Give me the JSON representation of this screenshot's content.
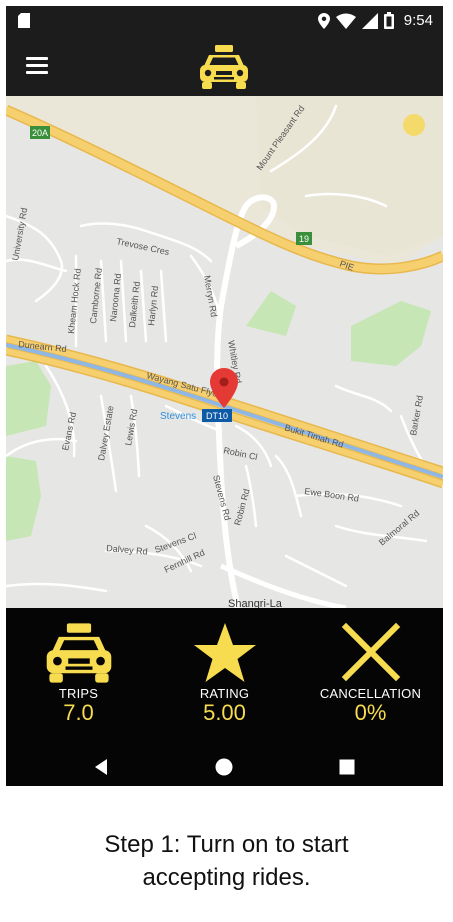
{
  "status_bar": {
    "time": "9:54",
    "icons": [
      "sd-card-icon",
      "location-icon",
      "wifi-icon",
      "signal-icon",
      "battery-icon"
    ]
  },
  "toolbar": {
    "menu_icon": "hamburger-menu-icon",
    "logo": "taxi-logo"
  },
  "map": {
    "labels": {
      "road_20a": "20A",
      "road_19": "19",
      "pie": "PIE",
      "mount_pleasant": "Mount Pleasant Rd",
      "university": "University Rd",
      "trevose": "Trevose Cres",
      "kheam_hock": "Kheam Hock Rd",
      "camborne": "Camborne Rd",
      "naroona": "Naroona Rd",
      "dalkeith": "Dalkeith Rd",
      "harlyn": "Harlyn Rd",
      "merryn": "Merryn Rd",
      "whitley": "Whitley Rd",
      "dunearn": "Dunearn Rd",
      "wayang": "Wayang Satu Flyover",
      "stevens_station": "Stevens",
      "station_code": "DT10",
      "bukit_timah": "Bukit Timah Rd",
      "barker": "Barker Rd",
      "evans": "Evans Rd",
      "dalvey_estate": "Dalvey Estate",
      "lewis": "Lewis Rd",
      "robin_cl": "Robin Cl",
      "stevens_rd": "Stevens Rd",
      "robin_rd": "Robin Rd",
      "ewe_boon": "Ewe Boon Rd",
      "balmoral": "Balmoral Rd",
      "dalvey_rd": "Dalvey Rd",
      "stevens_cl": "Stevens Cl",
      "fernhill": "Fernhill Rd",
      "shangri_la": "Shangri-La"
    },
    "colors": {
      "land": "#e6e6e4",
      "highway": "#f6cf6f",
      "highway_edge": "#e8b84c",
      "park": "#c6e6b5",
      "rail": "#8fb7e6",
      "pin": "#e53935"
    }
  },
  "stats": [
    {
      "label": "TRIPS",
      "value": "7.0",
      "icon": "taxi-icon"
    },
    {
      "label": "RATING",
      "value": "5.00",
      "icon": "star-icon"
    },
    {
      "label": "CANCELLATION",
      "value": "0%",
      "icon": "cross-icon"
    }
  ],
  "accent_color": "#f7dc4f",
  "nav": {
    "back": "back-icon",
    "home": "home-icon",
    "recents": "recents-icon"
  },
  "caption": {
    "line1": "Step 1: Turn on to start",
    "line2": "accepting rides."
  }
}
